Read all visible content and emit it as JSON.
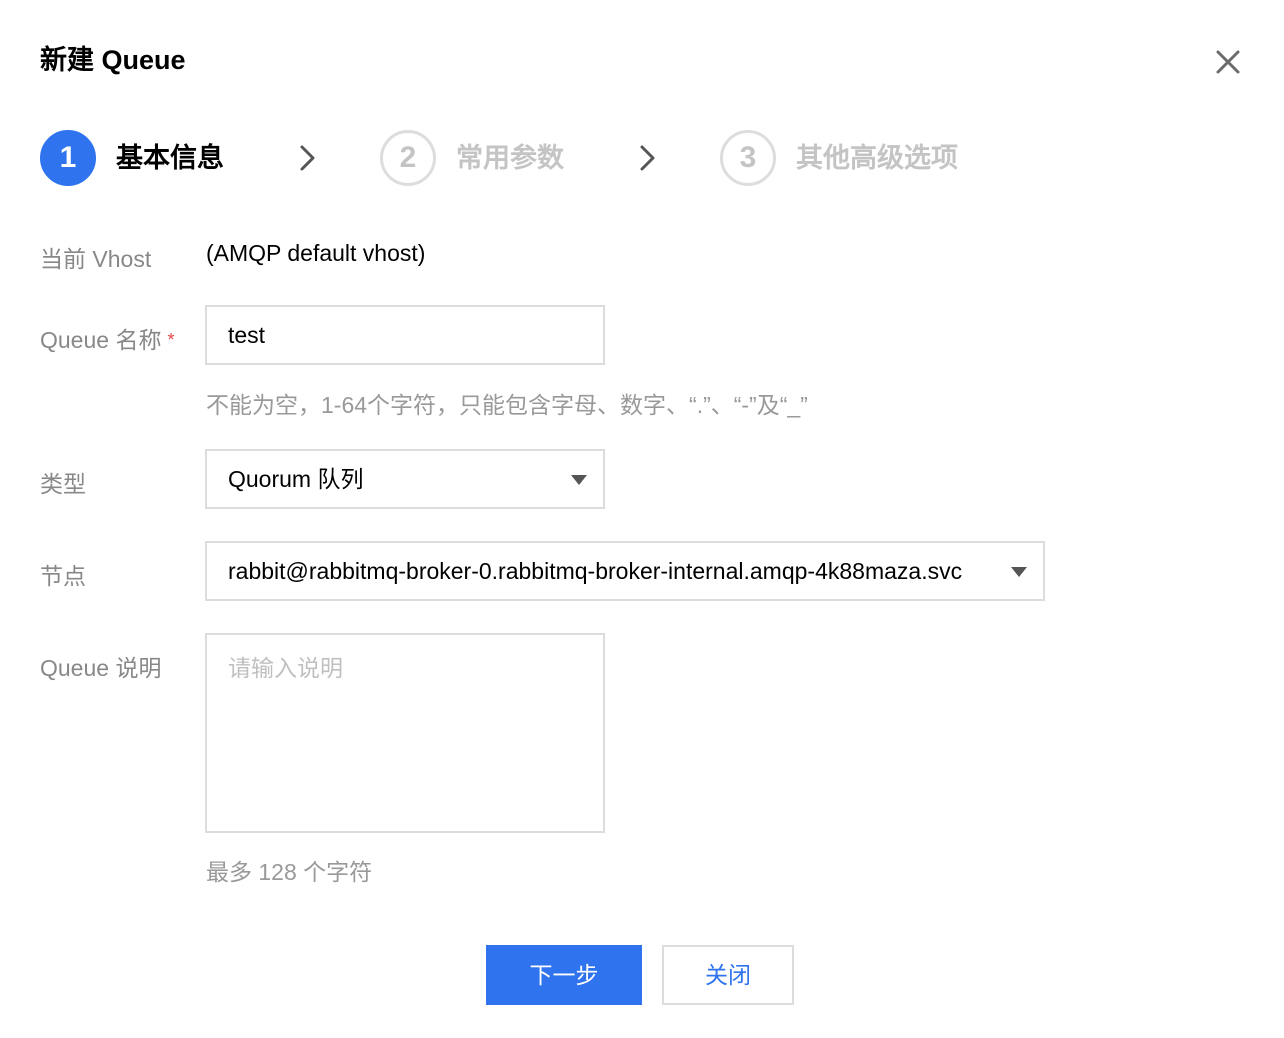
{
  "dialog": {
    "title": "新建 Queue",
    "close_icon": "close-icon"
  },
  "steps": [
    {
      "number": "1",
      "label": "基本信息",
      "state": "active"
    },
    {
      "number": "2",
      "label": "常用参数",
      "state": "inactive"
    },
    {
      "number": "3",
      "label": "其他高级选项",
      "state": "inactive"
    }
  ],
  "form": {
    "vhost": {
      "label": "当前 Vhost",
      "value": "(AMQP default vhost)"
    },
    "queue_name": {
      "label": "Queue 名称",
      "required_mark": "*",
      "value": "test",
      "hint": "不能为空，1-64个字符，只能包含字母、数字、“.”、“-”及“_”"
    },
    "type": {
      "label": "类型",
      "selected": "Quorum 队列"
    },
    "node": {
      "label": "节点",
      "selected": "rabbit@rabbitmq-broker-0.rabbitmq-broker-internal.amqp-4k88maza.svc"
    },
    "description": {
      "label": "Queue 说明",
      "placeholder": "请输入说明",
      "value": "",
      "hint": "最多 128 个字符"
    }
  },
  "actions": {
    "next_label": "下一步",
    "close_label": "关闭"
  },
  "colors": {
    "accent": "#2f74ee",
    "label_gray": "#888888",
    "hint_gray": "#999999",
    "inactive_gray": "#c4c4c4",
    "required_red": "#e54545",
    "border": "#dcdcdc"
  }
}
